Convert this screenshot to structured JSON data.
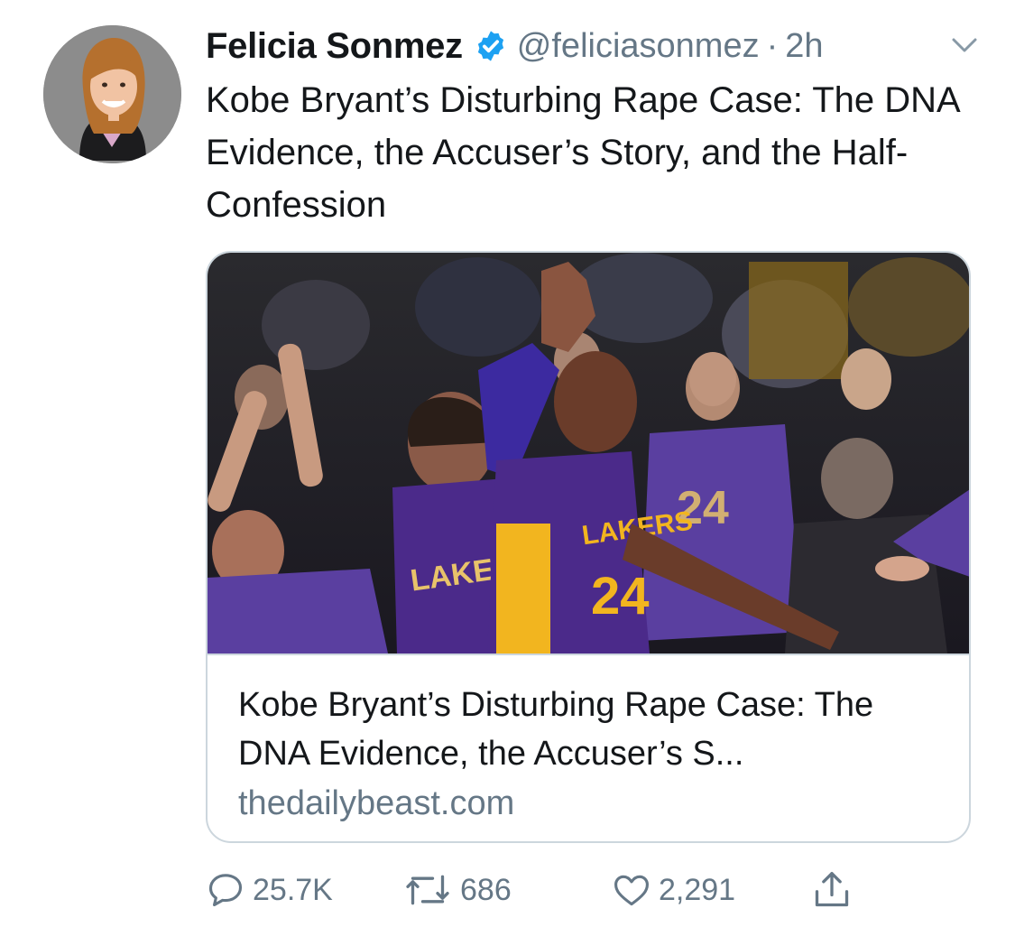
{
  "tweet": {
    "author_name": "Felicia Sonmez",
    "handle": "@feliciasonmez",
    "separator": "·",
    "timestamp": "2h",
    "text": "Kobe Bryant’s Disturbing Rape Case: The DNA Evidence, the Accuser’s Story, and the Half-Confession"
  },
  "card": {
    "title": "Kobe Bryant’s Disturbing Rape Case: The DNA Evidence, the Accuser’s S...",
    "domain": "thedailybeast.com",
    "image_jersey_text": "LAKERS",
    "image_jersey_number": "24"
  },
  "actions": {
    "replies": "25.7K",
    "retweets": "686",
    "likes": "2,291"
  },
  "icons": {
    "avatar": "avatar-photo",
    "verified": "verified-badge-icon",
    "menu": "chevron-down-icon",
    "reply": "reply-icon",
    "retweet": "retweet-icon",
    "like": "heart-icon",
    "share": "share-icon"
  },
  "colors": {
    "text_primary": "#14171a",
    "text_secondary": "#657786",
    "verified_blue": "#1da1f2",
    "border": "#ccd6dd",
    "lakers_purple": "#4b2a8a",
    "lakers_gold": "#f2b51f"
  }
}
